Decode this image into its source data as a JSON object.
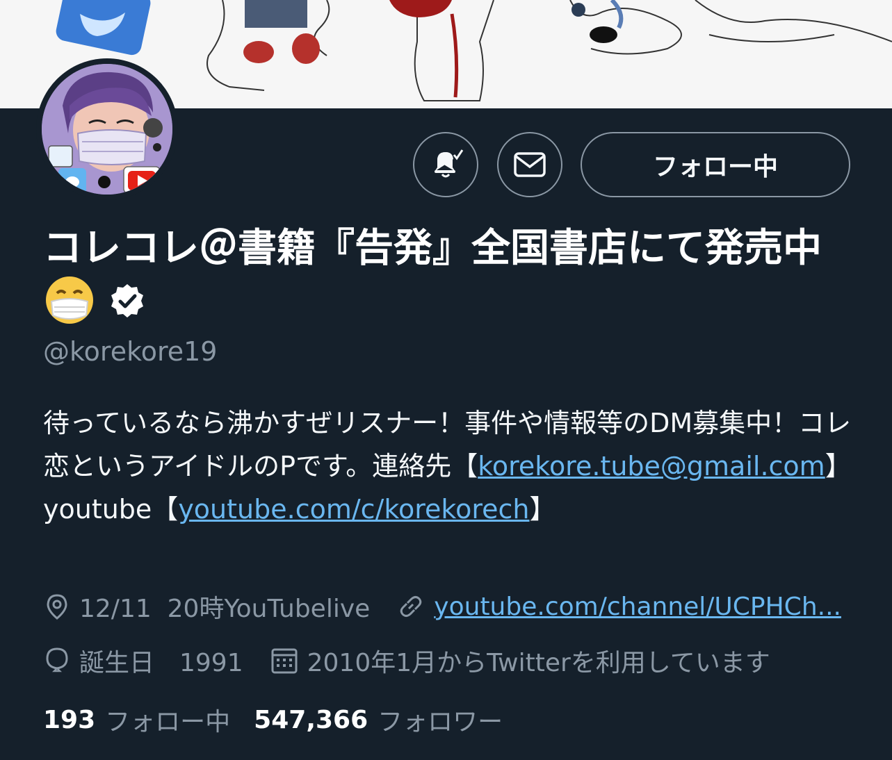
{
  "profile": {
    "display_name": "コレコレ＠書籍『告発』全国書店にて発売中",
    "handle": "@korekore19",
    "bio": {
      "text1": "待っているなら沸かすぜリスナー！事件や情報等のDM募集中！コレ恋というアイドルのPです。連絡先【",
      "email": "korekore.tube@gmail.com",
      "text2": "】youtube【",
      "youtube_link": "youtube.com/c/korekorech",
      "text3": "】"
    },
    "location": "12/11  20時YouTubelive",
    "website": "youtube.com/channel/UCPHCh...",
    "birthday": "誕生日　1991",
    "joined": "2010年1月からTwitterを利用しています"
  },
  "actions": {
    "follow_label": "フォロー中"
  },
  "stats": {
    "following_count": "193",
    "following_label": "フォロー中",
    "followers_count": "547,366",
    "followers_label": "フォロワー"
  },
  "colors": {
    "background": "#15202b",
    "link": "#6ab7f0",
    "secondary_text": "#8b98a5",
    "border": "#8b98a5"
  },
  "icons": [
    "notification-bell-icon",
    "message-icon",
    "verified-badge-icon",
    "location-icon",
    "link-icon",
    "birthday-balloon-icon",
    "calendar-icon",
    "mask-face-emoji"
  ]
}
